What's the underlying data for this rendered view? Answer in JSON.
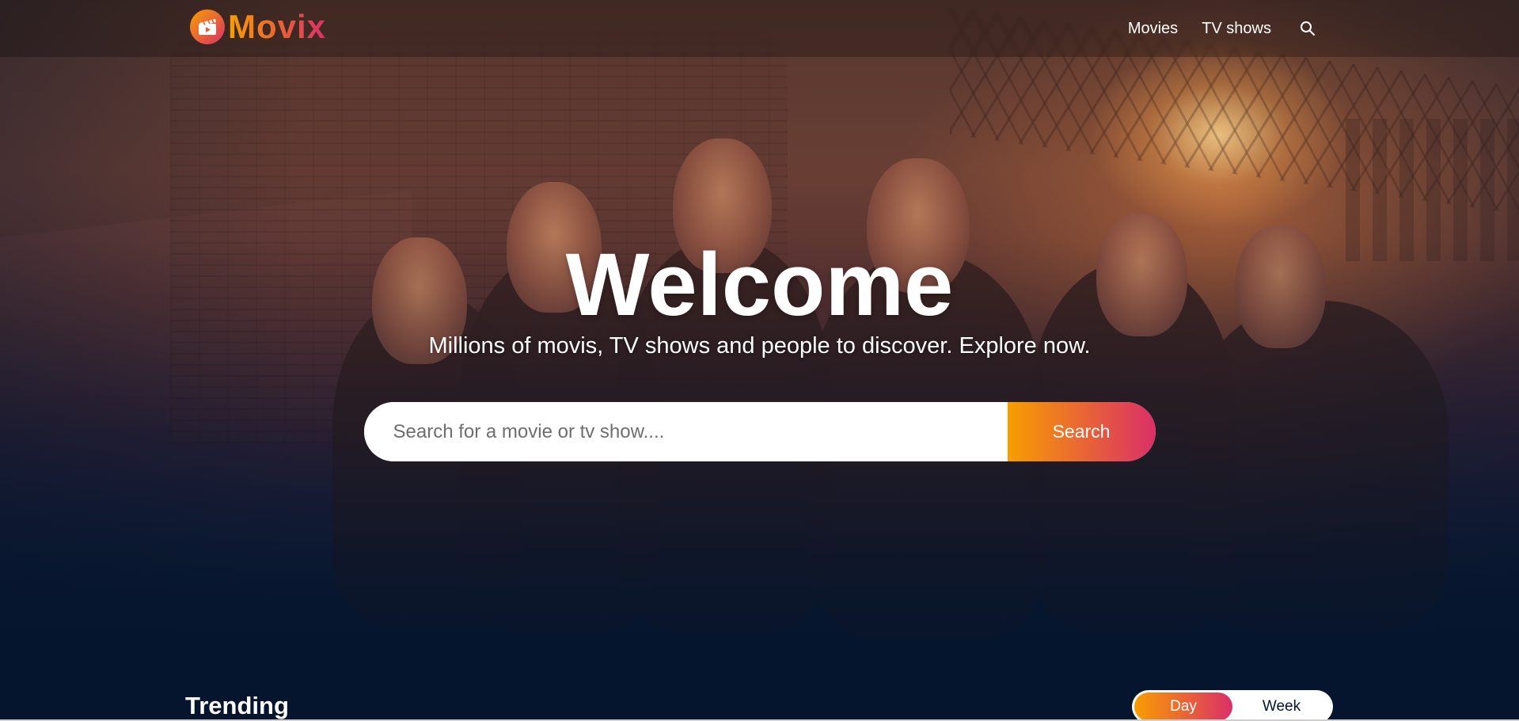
{
  "brand": {
    "name": "Movix",
    "logo_icon": "clapperboard-play-icon",
    "gradient_start": "#f89e00",
    "gradient_end": "#da2f68"
  },
  "header": {
    "nav_items": [
      {
        "label": "Movies"
      },
      {
        "label": "TV shows"
      }
    ],
    "search_icon": "search-icon"
  },
  "hero": {
    "title": "Welcome",
    "subtitle": "Millions of movis, TV shows and people to discover. Explore now.",
    "search": {
      "placeholder": "Search for a movie or tv show....",
      "value": "",
      "button_label": "Search"
    }
  },
  "trending": {
    "title": "Trending",
    "tabs": [
      {
        "label": "Day",
        "active": true
      },
      {
        "label": "Week",
        "active": false
      }
    ]
  },
  "colors": {
    "background": "#04152d",
    "text": "#ffffff"
  }
}
